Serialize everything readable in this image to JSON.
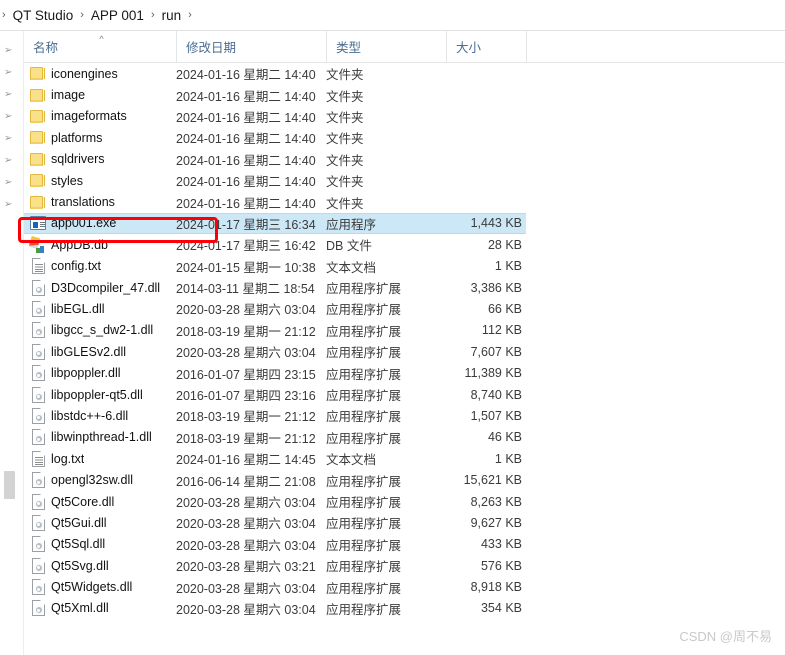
{
  "window": {
    "title": "run"
  },
  "breadcrumb": {
    "lead_chevron": "›",
    "separator": "›",
    "items": [
      {
        "label": "QT Studio"
      },
      {
        "label": "APP 001"
      },
      {
        "label": "run"
      }
    ]
  },
  "columns": [
    {
      "key": "name",
      "label": "名称"
    },
    {
      "key": "date",
      "label": "修改日期"
    },
    {
      "key": "type",
      "label": "类型"
    },
    {
      "key": "size",
      "label": "大小"
    }
  ],
  "sort": {
    "column": "名称",
    "direction": "ascending",
    "caret_glyph": "^"
  },
  "rows": [
    {
      "icon": "folder-icon",
      "name": "iconengines",
      "date": "2024-01-16 星期二 14:40",
      "type": "文件夹",
      "size": "",
      "selected": false
    },
    {
      "icon": "folder-icon",
      "name": "image",
      "date": "2024-01-16 星期二 14:40",
      "type": "文件夹",
      "size": "",
      "selected": false
    },
    {
      "icon": "folder-icon",
      "name": "imageformats",
      "date": "2024-01-16 星期二 14:40",
      "type": "文件夹",
      "size": "",
      "selected": false
    },
    {
      "icon": "folder-icon",
      "name": "platforms",
      "date": "2024-01-16 星期二 14:40",
      "type": "文件夹",
      "size": "",
      "selected": false
    },
    {
      "icon": "folder-icon",
      "name": "sqldrivers",
      "date": "2024-01-16 星期二 14:40",
      "type": "文件夹",
      "size": "",
      "selected": false
    },
    {
      "icon": "folder-icon",
      "name": "styles",
      "date": "2024-01-16 星期二 14:40",
      "type": "文件夹",
      "size": "",
      "selected": false
    },
    {
      "icon": "folder-icon",
      "name": "translations",
      "date": "2024-01-16 星期二 14:40",
      "type": "文件夹",
      "size": "",
      "selected": false
    },
    {
      "icon": "exe-icon",
      "name": "app001.exe",
      "date": "2024-01-17 星期三 16:34",
      "type": "应用程序",
      "size": "1,443 KB",
      "selected": true
    },
    {
      "icon": "db-icon",
      "name": "AppDB.db",
      "date": "2024-01-17 星期三 16:42",
      "type": "DB 文件",
      "size": "28 KB",
      "selected": false
    },
    {
      "icon": "text-doc-icon",
      "name": "config.txt",
      "date": "2024-01-15 星期一 10:38",
      "type": "文本文档",
      "size": "1 KB",
      "selected": false
    },
    {
      "icon": "dll-icon",
      "name": "D3Dcompiler_47.dll",
      "date": "2014-03-11 星期二 18:54",
      "type": "应用程序扩展",
      "size": "3,386 KB",
      "selected": false
    },
    {
      "icon": "dll-icon",
      "name": "libEGL.dll",
      "date": "2020-03-28 星期六 03:04",
      "type": "应用程序扩展",
      "size": "66 KB",
      "selected": false
    },
    {
      "icon": "dll-icon",
      "name": "libgcc_s_dw2-1.dll",
      "date": "2018-03-19 星期一 21:12",
      "type": "应用程序扩展",
      "size": "112 KB",
      "selected": false
    },
    {
      "icon": "dll-icon",
      "name": "libGLESv2.dll",
      "date": "2020-03-28 星期六 03:04",
      "type": "应用程序扩展",
      "size": "7,607 KB",
      "selected": false
    },
    {
      "icon": "dll-icon",
      "name": "libpoppler.dll",
      "date": "2016-01-07 星期四 23:15",
      "type": "应用程序扩展",
      "size": "11,389 KB",
      "selected": false
    },
    {
      "icon": "dll-icon",
      "name": "libpoppler-qt5.dll",
      "date": "2016-01-07 星期四 23:16",
      "type": "应用程序扩展",
      "size": "8,740 KB",
      "selected": false
    },
    {
      "icon": "dll-icon",
      "name": "libstdc++-6.dll",
      "date": "2018-03-19 星期一 21:12",
      "type": "应用程序扩展",
      "size": "1,507 KB",
      "selected": false
    },
    {
      "icon": "dll-icon",
      "name": "libwinpthread-1.dll",
      "date": "2018-03-19 星期一 21:12",
      "type": "应用程序扩展",
      "size": "46 KB",
      "selected": false
    },
    {
      "icon": "text-doc-icon",
      "name": "log.txt",
      "date": "2024-01-16 星期二 14:45",
      "type": "文本文档",
      "size": "1 KB",
      "selected": false
    },
    {
      "icon": "dll-icon",
      "name": "opengl32sw.dll",
      "date": "2016-06-14 星期二 21:08",
      "type": "应用程序扩展",
      "size": "15,621 KB",
      "selected": false
    },
    {
      "icon": "dll-icon",
      "name": "Qt5Core.dll",
      "date": "2020-03-28 星期六 03:04",
      "type": "应用程序扩展",
      "size": "8,263 KB",
      "selected": false
    },
    {
      "icon": "dll-icon",
      "name": "Qt5Gui.dll",
      "date": "2020-03-28 星期六 03:04",
      "type": "应用程序扩展",
      "size": "9,627 KB",
      "selected": false
    },
    {
      "icon": "dll-icon",
      "name": "Qt5Sql.dll",
      "date": "2020-03-28 星期六 03:04",
      "type": "应用程序扩展",
      "size": "433 KB",
      "selected": false
    },
    {
      "icon": "dll-icon",
      "name": "Qt5Svg.dll",
      "date": "2020-03-28 星期六 03:21",
      "type": "应用程序扩展",
      "size": "576 KB",
      "selected": false
    },
    {
      "icon": "dll-icon",
      "name": "Qt5Widgets.dll",
      "date": "2020-03-28 星期六 03:04",
      "type": "应用程序扩展",
      "size": "8,918 KB",
      "selected": false
    },
    {
      "icon": "dll-icon",
      "name": "Qt5Xml.dll",
      "date": "2020-03-28 星期六 03:04",
      "type": "应用程序扩展",
      "size": "354 KB",
      "selected": false
    }
  ],
  "annotation": {
    "shape": "rectangle",
    "color": "#fb0007",
    "targets_row": "app001.exe"
  },
  "watermark": {
    "text": "CSDN @周不易"
  },
  "colors": {
    "selection_fill": "#cce8f6",
    "selection_border": "#b5dcf0",
    "column_header_text": "#4a6c93",
    "annotation_red": "#fb0007",
    "folder_yellow": "#fbe08a",
    "watermark_gray": "#c9c9c9"
  }
}
